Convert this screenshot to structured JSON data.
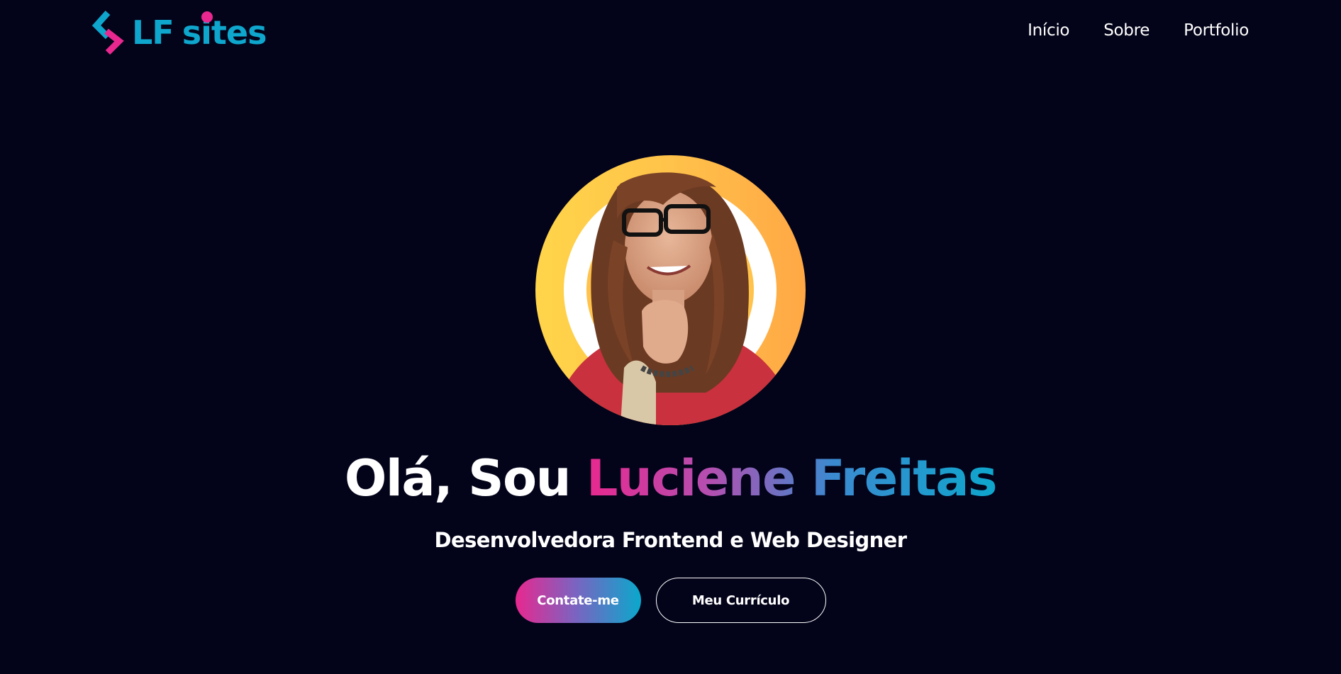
{
  "brand": {
    "name_part1": "LF",
    "name_part2": "sites",
    "colors": {
      "cyan": "#0ea6cc",
      "pink": "#e8288f"
    }
  },
  "nav": {
    "items": [
      {
        "label": "Início"
      },
      {
        "label": "Sobre"
      },
      {
        "label": "Portfolio"
      }
    ]
  },
  "hero": {
    "avatar": "profile-photo",
    "headline_prefix": "Olá, Sou",
    "headline_name_first": "Luciene",
    "headline_name_last": "Freitas",
    "subtitle": "Desenvolvedora Frontend e Web Designer",
    "primary_button": "Contate-me",
    "secondary_button": "Meu Currículo"
  },
  "theme": {
    "background": "#03031a",
    "gradient_start": "#e8288f",
    "gradient_end": "#0ea6cc",
    "avatar_ring": "#ffc24a"
  }
}
